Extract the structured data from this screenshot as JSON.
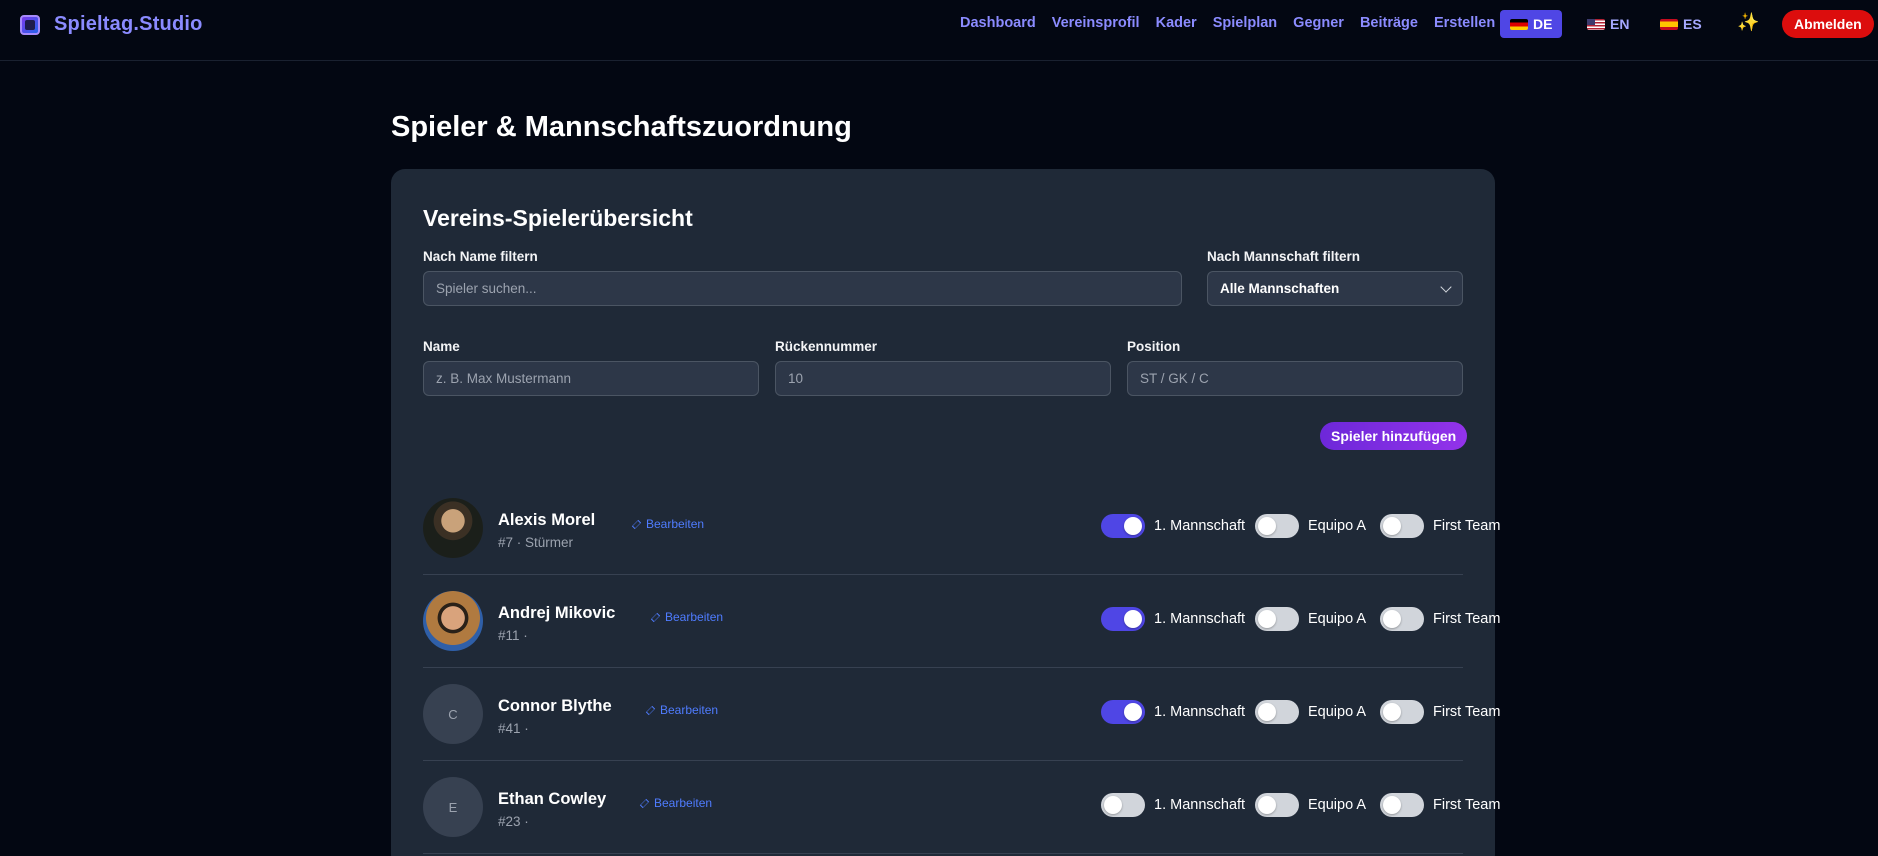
{
  "app": {
    "brand": "Spieltag.Studio"
  },
  "nav": {
    "items": [
      "Dashboard",
      "Vereinsprofil",
      "Kader",
      "Spielplan",
      "Gegner",
      "Beiträge",
      "Erstellen"
    ],
    "languages": [
      {
        "code": "DE",
        "active": true
      },
      {
        "code": "EN",
        "active": false
      },
      {
        "code": "ES",
        "active": false
      }
    ],
    "logout": "Abmelden"
  },
  "page": {
    "title": "Spieler & Mannschaftszuordnung"
  },
  "card": {
    "title": "Vereins-Spielerübersicht",
    "filter_name_label": "Nach Name filtern",
    "filter_name_placeholder": "Spieler suchen...",
    "filter_team_label": "Nach Mannschaft filtern",
    "filter_team_value": "Alle Mannschaften",
    "name_label": "Name",
    "name_placeholder": "z. B. Max Mustermann",
    "number_label": "Rückennummer",
    "number_placeholder": "10",
    "position_label": "Position",
    "position_placeholder": "ST / GK / C",
    "add_button": "Spieler hinzufügen"
  },
  "teams": [
    "1. Mannschaft",
    "Equipo A",
    "First Team"
  ],
  "players": [
    {
      "name": "Alexis Morel",
      "meta": "#7 · Stürmer",
      "initial": "",
      "edit": "Bearbeiten",
      "teams_on": [
        true,
        false,
        false
      ]
    },
    {
      "name": "Andrej Mikovic",
      "meta": "#11 ·",
      "initial": "",
      "edit": "Bearbeiten",
      "teams_on": [
        true,
        false,
        false
      ]
    },
    {
      "name": "Connor Blythe",
      "meta": "#41 ·",
      "initial": "C",
      "edit": "Bearbeiten",
      "teams_on": [
        true,
        false,
        false
      ]
    },
    {
      "name": "Ethan Cowley",
      "meta": "#23 ·",
      "initial": "E",
      "edit": "Bearbeiten",
      "teams_on": [
        false,
        false,
        false
      ]
    }
  ],
  "colors": {
    "accent": "#4f46e5",
    "logout": "#dc0d0d",
    "link": "#8b8bff"
  }
}
